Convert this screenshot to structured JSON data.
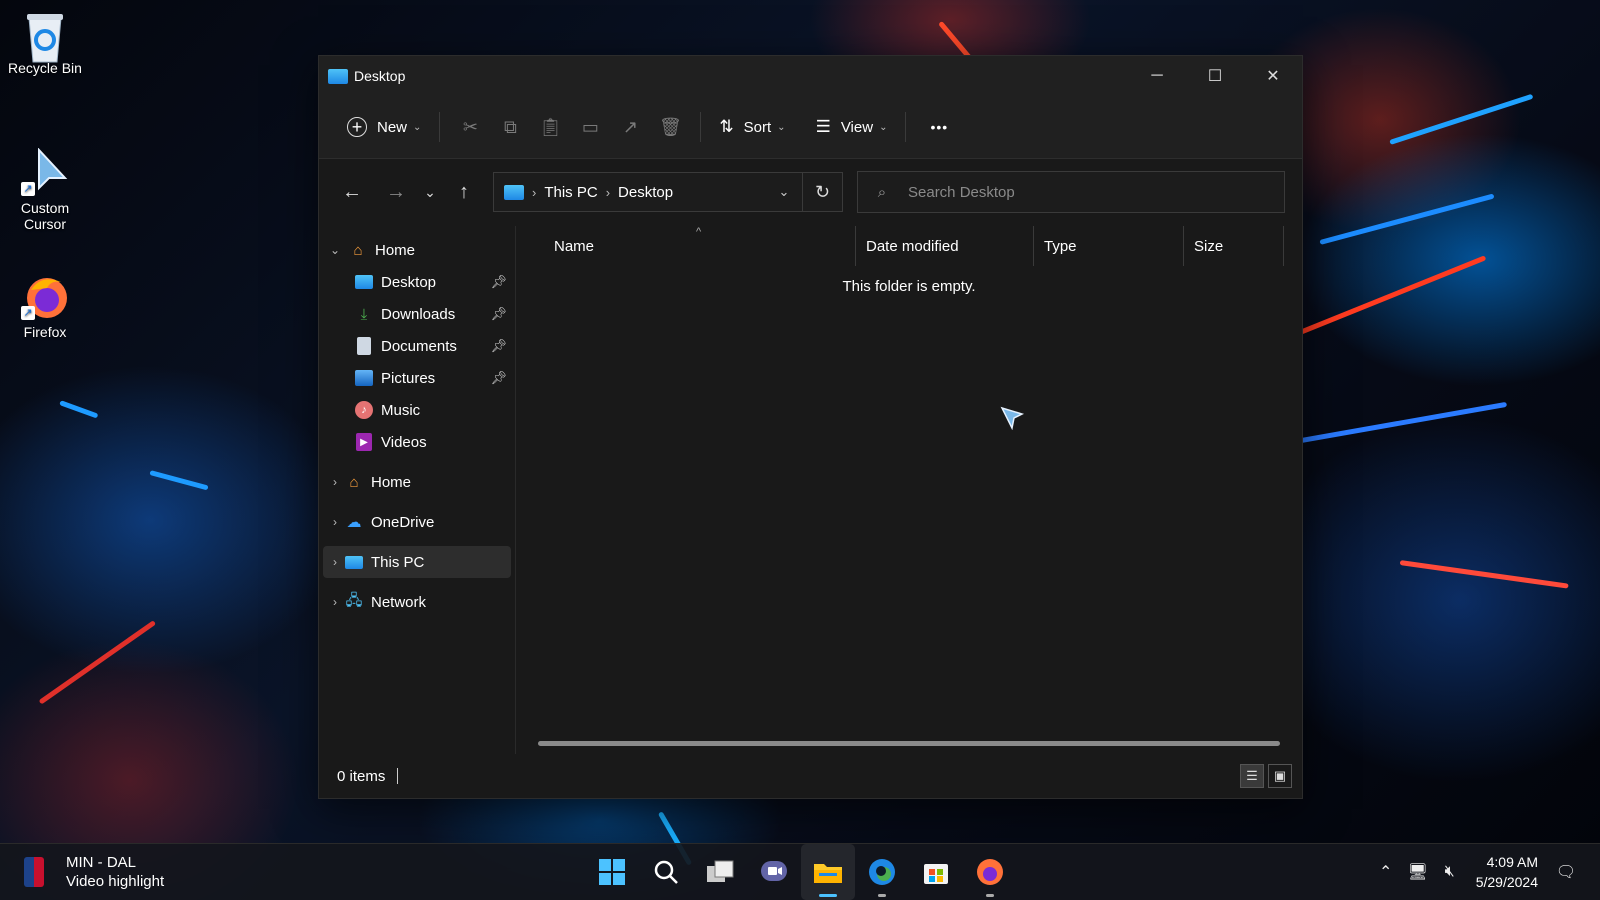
{
  "desktop": {
    "icons": [
      {
        "label": "Recycle Bin"
      },
      {
        "label": "Custom\nCursor"
      },
      {
        "label": "Firefox"
      }
    ]
  },
  "window": {
    "title": "Desktop",
    "controls": {
      "minimize": "─",
      "maximize": "☐",
      "close": "✕"
    }
  },
  "toolbar": {
    "new_label": "New",
    "sort_label": "Sort",
    "view_label": "View",
    "more_label": "•••",
    "icons": [
      "cut-icon",
      "copy-icon",
      "paste-icon",
      "rename-icon",
      "share-icon",
      "delete-icon"
    ]
  },
  "navbar": {
    "breadcrumb": [
      "This PC",
      "Desktop"
    ],
    "search_placeholder": "Search Desktop"
  },
  "sidebar": {
    "home_expanded": "Home",
    "quick_access": [
      {
        "label": "Desktop",
        "pinned": true
      },
      {
        "label": "Downloads",
        "pinned": true
      },
      {
        "label": "Documents",
        "pinned": true
      },
      {
        "label": "Pictures",
        "pinned": true
      },
      {
        "label": "Music",
        "pinned": false
      },
      {
        "label": "Videos",
        "pinned": false
      }
    ],
    "roots": [
      "Home",
      "OneDrive",
      "This PC",
      "Network"
    ],
    "selected": "This PC"
  },
  "content": {
    "columns": [
      "Name",
      "Date modified",
      "Type",
      "Size"
    ],
    "empty_message": "This folder is empty."
  },
  "status": {
    "items": "0 items"
  },
  "taskbar": {
    "widget_title": "MIN - DAL",
    "widget_subtitle": "Video highlight",
    "time": "4:09 AM",
    "date": "5/29/2024",
    "accent": "#4cc2ff"
  }
}
